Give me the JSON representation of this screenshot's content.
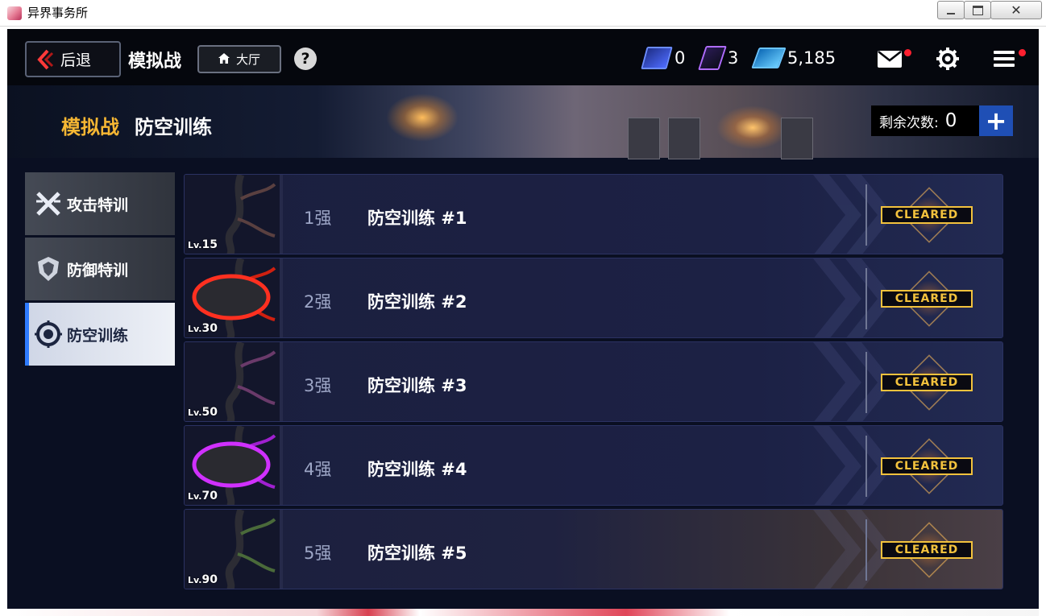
{
  "window": {
    "title": "异界事务所"
  },
  "topbar": {
    "back_label": "后退",
    "page_name": "模拟战",
    "home_label": "大厅",
    "help_symbol": "?",
    "resources": [
      {
        "icon": "ticket-icon",
        "value": "0"
      },
      {
        "icon": "purple-ticket-icon",
        "value": "3"
      },
      {
        "icon": "book-icon",
        "value": "5,185"
      }
    ]
  },
  "banner": {
    "category": "模拟战",
    "title": "防空训练",
    "remaining_label": "剩余次数:",
    "remaining_value": "0",
    "plus_symbol": "+"
  },
  "sidebar": {
    "items": [
      {
        "label": "攻击特训",
        "icon": "crossed-swords-icon",
        "active": false
      },
      {
        "label": "防御特训",
        "icon": "shield-icon",
        "active": false
      },
      {
        "label": "防空训练",
        "icon": "anti-air-icon",
        "active": true
      }
    ]
  },
  "stages": [
    {
      "lv_prefix": "Lv.",
      "lv": "15",
      "strength": "1强",
      "name": "防空训练 #1",
      "status": "CLEARED"
    },
    {
      "lv_prefix": "Lv.",
      "lv": "30",
      "strength": "2强",
      "name": "防空训练 #2",
      "status": "CLEARED"
    },
    {
      "lv_prefix": "Lv.",
      "lv": "50",
      "strength": "3强",
      "name": "防空训练 #3",
      "status": "CLEARED"
    },
    {
      "lv_prefix": "Lv.",
      "lv": "70",
      "strength": "4强",
      "name": "防空训练 #4",
      "status": "CLEARED"
    },
    {
      "lv_prefix": "Lv.",
      "lv": "90",
      "strength": "5强",
      "name": "防空训练 #5",
      "status": "CLEARED"
    }
  ],
  "colors": {
    "accent_gold": "#f7b733",
    "cleared_gold": "#f3c23d",
    "notify_red": "#ff2030",
    "plus_blue": "#1f4fb5",
    "active_side": "#2e7bff"
  }
}
